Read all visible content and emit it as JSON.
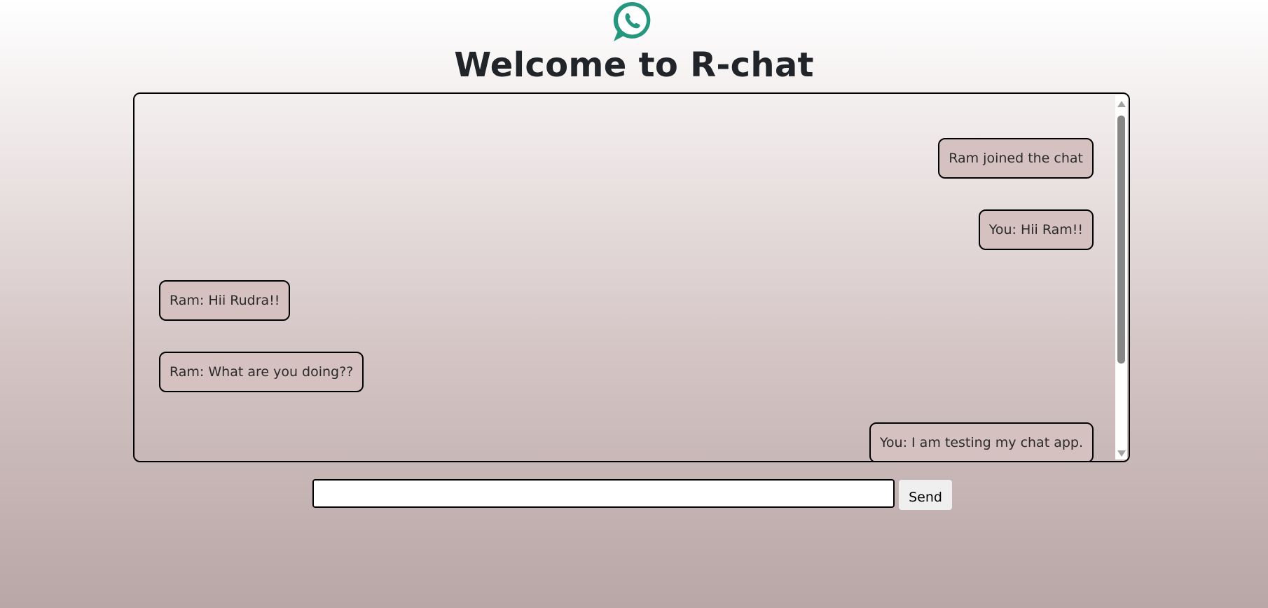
{
  "app": {
    "title": "Welcome to R-chat",
    "logo_icon": "whatsapp-icon",
    "accent_color": "#25977f"
  },
  "messages": [
    {
      "text": "Ram joined the chat",
      "align": "right"
    },
    {
      "text": "You: Hii Ram!!",
      "align": "right"
    },
    {
      "text": "Ram: Hii Rudra!!",
      "align": "left"
    },
    {
      "text": "Ram: What are you doing??",
      "align": "left"
    },
    {
      "text": "You: I am testing my chat app.",
      "align": "right"
    }
  ],
  "compose": {
    "input_value": "",
    "input_placeholder": "",
    "send_label": "Send"
  }
}
